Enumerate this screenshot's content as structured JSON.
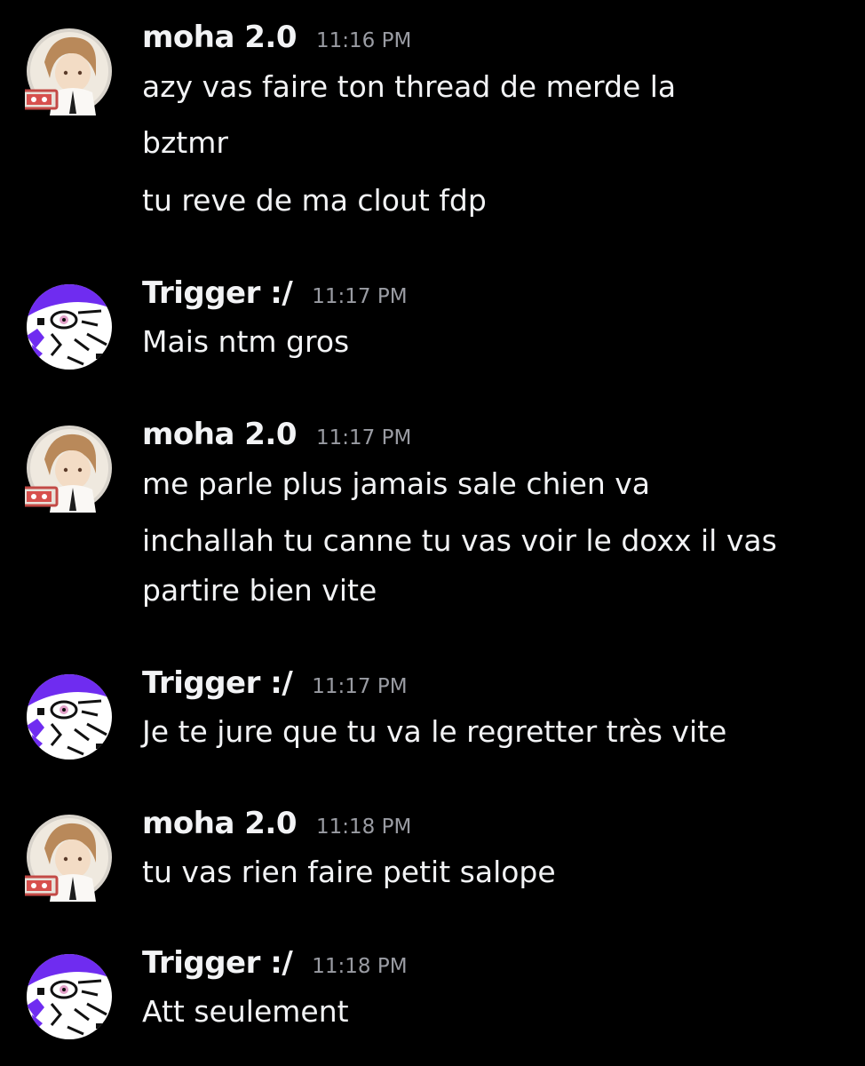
{
  "messages": [
    {
      "author": "moha 2.0",
      "avatar": "moha-avatar-icon",
      "time": "11:16 PM",
      "lines": [
        "azy vas faire ton thread de merde la",
        "bztmr",
        "tu reve de ma clout fdp"
      ]
    },
    {
      "author": "Trigger :/",
      "avatar": "trigger-avatar-icon",
      "time": "11:17 PM",
      "lines": [
        "Mais ntm gros"
      ]
    },
    {
      "author": "moha 2.0",
      "avatar": "moha-avatar-icon",
      "time": "11:17 PM",
      "lines": [
        "me parle plus jamais sale chien va",
        "inchallah tu canne tu vas voir le doxx il vas",
        "partire bien vite"
      ]
    },
    {
      "author": "Trigger :/",
      "avatar": "trigger-avatar-icon",
      "time": "11:17 PM",
      "lines": [
        "Je te jure que tu va le regretter très vite"
      ]
    },
    {
      "author": "moha 2.0",
      "avatar": "moha-avatar-icon",
      "time": "11:18 PM",
      "lines": [
        "tu vas rien faire petit salope"
      ]
    },
    {
      "author": "Trigger :/",
      "avatar": "trigger-avatar-icon",
      "time": "11:18 PM",
      "lines": [
        "Att seulement"
      ]
    }
  ],
  "colors": {
    "background": "#000000",
    "text": "#f2f3f5",
    "timestamp": "#9a9ca3",
    "trigger_accent": "#6f2cf0"
  }
}
